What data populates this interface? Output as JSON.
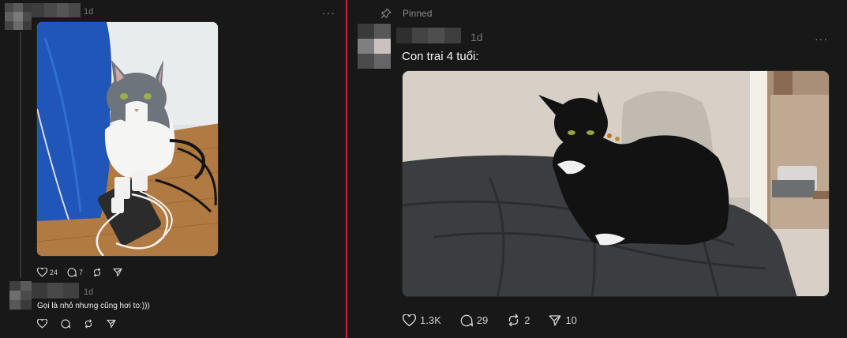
{
  "left_post": {
    "time": "1d",
    "more": "···",
    "likes": "24",
    "replies": "7"
  },
  "reply": {
    "time": "1d",
    "text": "Gọi là nhỏ nhưng cũng hơi to:)))"
  },
  "right_post": {
    "pinned_label": "Pinned",
    "time": "1d",
    "more": "···",
    "caption": "Con trai 4 tuổi:",
    "likes": "1.3K",
    "replies": "29",
    "reposts": "2",
    "shares": "10"
  },
  "colors": {
    "background": "#181818",
    "divider": "#d8262f",
    "muted": "#777777"
  }
}
